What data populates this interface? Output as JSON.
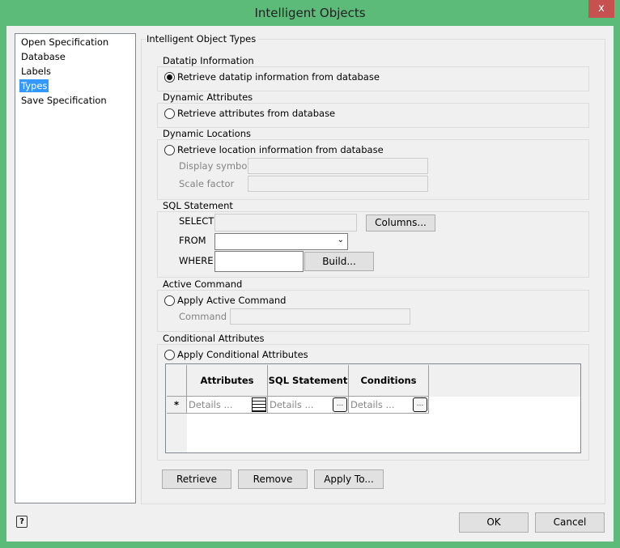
{
  "window": {
    "title": "Intelligent Objects",
    "close": "x"
  },
  "nav": {
    "items": [
      {
        "label": "Open Specification"
      },
      {
        "label": "Database"
      },
      {
        "label": "Labels"
      },
      {
        "label": "Types",
        "selected": true
      },
      {
        "label": "Save Specification"
      }
    ]
  },
  "main": {
    "title": "Intelligent Object Types",
    "datatip": {
      "title": "Datatip Information",
      "radio": "Retrieve datatip information from database",
      "checked": true
    },
    "dynattr": {
      "title": "Dynamic Attributes",
      "radio": "Retrieve attributes from database",
      "checked": false
    },
    "dynloc": {
      "title": "Dynamic Locations",
      "radio": "Retrieve location information from database",
      "checked": false,
      "display_symbol": "Display symbol",
      "scale_factor": "Scale factor"
    },
    "sql": {
      "title": "SQL Statement",
      "select": "SELECT",
      "from": "FROM",
      "where": "WHERE",
      "columns_btn": "Columns...",
      "build_btn": "Build..."
    },
    "active": {
      "title": "Active Command",
      "radio": "Apply Active Command",
      "checked": false,
      "command": "Command"
    },
    "cond": {
      "title": "Conditional Attributes",
      "radio": "Apply Conditional Attributes",
      "checked": false,
      "columns": [
        "Attributes",
        "SQL Statement",
        "Conditions"
      ],
      "row": {
        "marker": "*",
        "cells": [
          "Details ...",
          "Details ...",
          "Details ..."
        ],
        "ellipsis": "..."
      }
    },
    "buttons": {
      "retrieve": "Retrieve",
      "remove": "Remove",
      "apply_to": "Apply To..."
    }
  },
  "footer": {
    "help": "?",
    "ok": "OK",
    "cancel": "Cancel"
  }
}
